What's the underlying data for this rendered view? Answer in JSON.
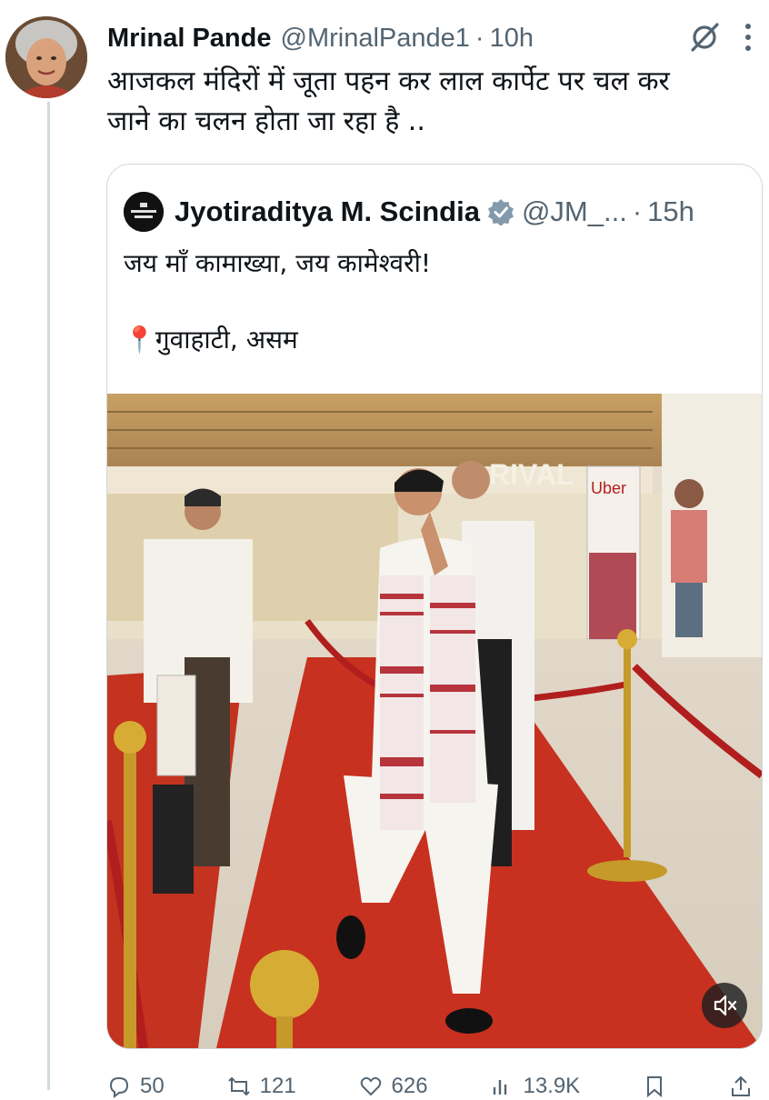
{
  "tweet": {
    "author_name": "Mrinal Pande",
    "author_handle": "@MrinalPande1",
    "separator": "·",
    "time": "10h",
    "text": "आजकल मंदिरों में जूता पहन कर लाल कार्पेट पर चल कर\nजाने का चलन होता जा रहा है .."
  },
  "quoted": {
    "author_name": "Jyotiraditya M. Scindia",
    "author_handle": "@JM_...",
    "separator": "·",
    "time": "15h",
    "text": "जय माँ कामाख्या, जय कामेश्वरी!\n\n📍गुवाहाटी, असम",
    "sign_text": "RIVAL",
    "uber_text": "Uber"
  },
  "actions": {
    "replies": "50",
    "reposts": "121",
    "likes": "626",
    "views": "13.9K"
  },
  "icons": {
    "grok": "grok-icon",
    "more": "more-icon",
    "verified": "verified-badge-icon",
    "mute": "mute-icon",
    "reply": "reply-icon",
    "repost": "repost-icon",
    "like": "like-icon",
    "views": "views-icon",
    "bookmark": "bookmark-icon",
    "share": "share-icon"
  },
  "colors": {
    "text": "#0f1419",
    "secondary": "#536471",
    "border": "#cfd9de",
    "carpet": "#c8311f",
    "verified_badge": "#829aab"
  }
}
